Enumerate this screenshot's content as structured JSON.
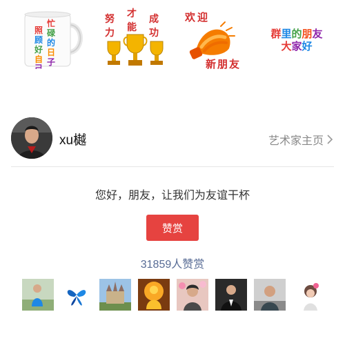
{
  "stickers": {
    "mug_text": [
      "忙",
      "碌",
      "的",
      "日",
      "子",
      "照",
      "顾",
      "好",
      "自",
      "己"
    ],
    "trophy_text": [
      "努",
      "力",
      "才",
      "能",
      "成",
      "功"
    ],
    "welcome_text": [
      "欢",
      "迎",
      "新",
      "朋",
      "友"
    ],
    "friends_line1": [
      "群",
      "里",
      "的",
      "朋",
      "友"
    ],
    "friends_line2": [
      "大",
      "家",
      "好"
    ],
    "friends_colors1": [
      "#e53935",
      "#1e88e5",
      "#43a047",
      "#f4511e",
      "#8e24aa"
    ],
    "friends_colors2": [
      "#e53935",
      "#8e24aa",
      "#1e88e5"
    ]
  },
  "author": {
    "name": "xu樾",
    "home_link": "艺术家主页",
    "avatar_icon": "person-avatar"
  },
  "message": "您好，朋友，让我们为友谊干杯",
  "reward": {
    "button_label": "赞赏",
    "count_text": "31859人赞赏",
    "button_color": "#e64340",
    "count_color": "#576b95"
  },
  "rewarders": [
    {
      "icon": "woman-in-blue-avatar"
    },
    {
      "icon": "blue-butterfly-avatar"
    },
    {
      "icon": "castle-avatar"
    },
    {
      "icon": "buddha-avatar"
    },
    {
      "icon": "woman-with-flowers-avatar"
    },
    {
      "icon": "man-in-suit-avatar"
    },
    {
      "icon": "older-man-avatar"
    },
    {
      "icon": "girl-with-flower-avatar"
    }
  ]
}
